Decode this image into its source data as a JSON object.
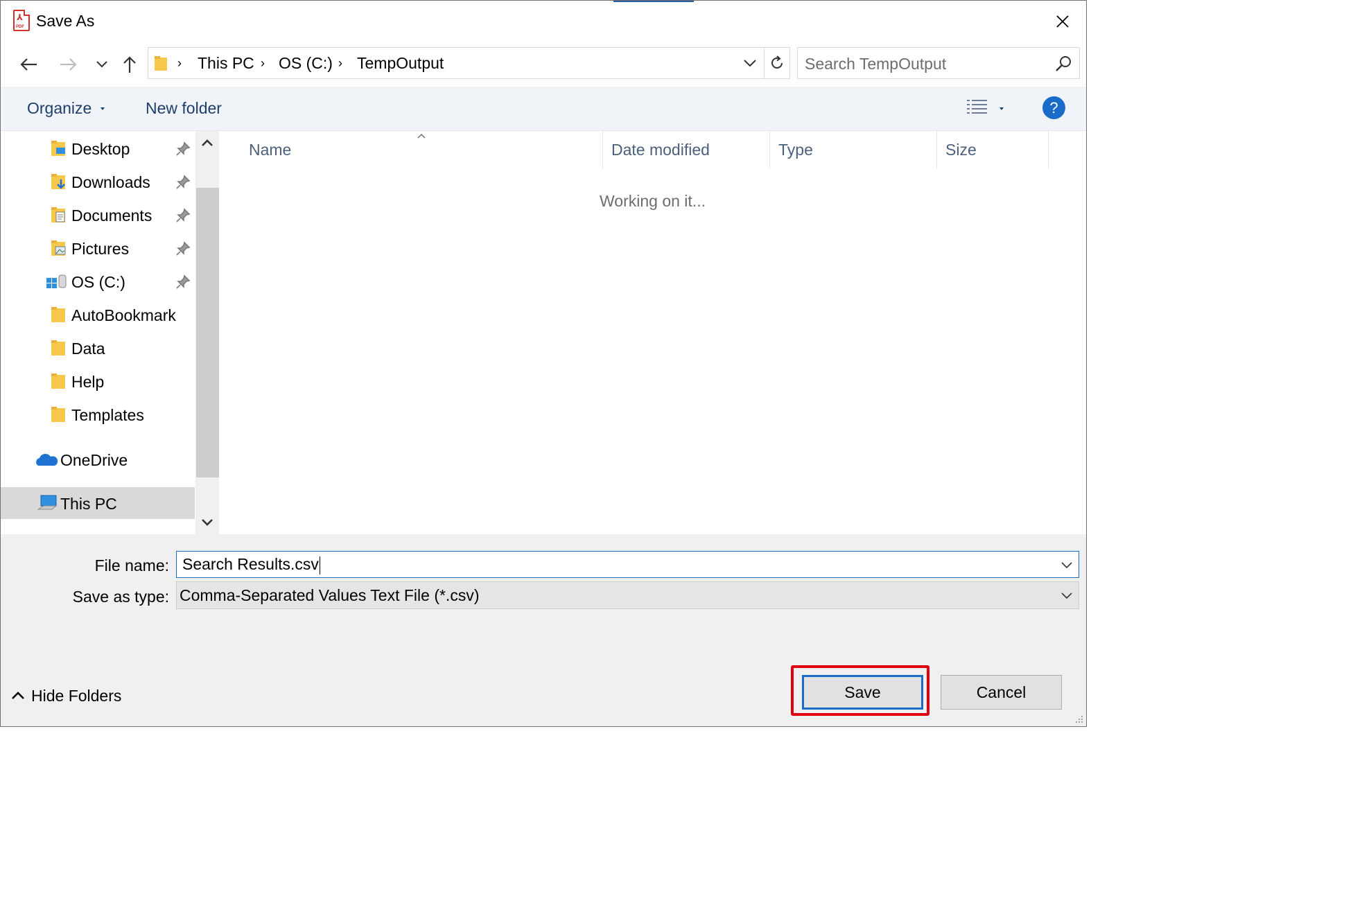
{
  "window": {
    "title": "Save As",
    "app_icon": "pdf-icon",
    "close_icon": "close-icon"
  },
  "navigation": {
    "back_icon": "back-arrow-icon",
    "forward_icon": "forward-arrow-icon",
    "recent_icon": "chevron-down-icon",
    "up_icon": "up-arrow-icon",
    "breadcrumb": [
      "This PC",
      "OS (C:)",
      "TempOutput"
    ],
    "refresh_icon": "refresh-icon",
    "search_placeholder": "Search TempOutput"
  },
  "toolbar": {
    "organize_label": "Organize",
    "new_folder_label": "New folder",
    "view_icon": "details-view-icon",
    "help_label": "?"
  },
  "sidebar": {
    "quick_access": [
      {
        "label": "Desktop",
        "icon": "desktop-folder-icon",
        "pinned": true
      },
      {
        "label": "Downloads",
        "icon": "downloads-folder-icon",
        "pinned": true
      },
      {
        "label": "Documents",
        "icon": "documents-folder-icon",
        "pinned": true
      },
      {
        "label": "Pictures",
        "icon": "pictures-folder-icon",
        "pinned": true
      },
      {
        "label": "OS (C:)",
        "icon": "drive-icon",
        "pinned": true
      },
      {
        "label": "AutoBookmark",
        "icon": "folder-icon",
        "pinned": false
      },
      {
        "label": "Data",
        "icon": "folder-icon",
        "pinned": false
      },
      {
        "label": "Help",
        "icon": "folder-icon",
        "pinned": false
      },
      {
        "label": "Templates",
        "icon": "folder-icon",
        "pinned": false
      }
    ],
    "onedrive_label": "OneDrive",
    "this_pc_label": "This PC"
  },
  "filelist": {
    "columns": [
      "Name",
      "Date modified",
      "Type",
      "Size"
    ],
    "status_text": "Working on it..."
  },
  "form": {
    "file_name_label": "File name:",
    "file_name_value": "Search Results.csv",
    "save_type_label": "Save as type:",
    "save_type_value": "Comma-Separated Values Text File (*.csv)"
  },
  "footer": {
    "hide_folders_label": "Hide Folders",
    "save_label": "Save",
    "cancel_label": "Cancel"
  },
  "colors": {
    "accent": "#1b6cc8",
    "highlight": "#e0000f",
    "toolbar_bg": "#f0f4f9",
    "panel_bg": "#f0f0f0"
  }
}
